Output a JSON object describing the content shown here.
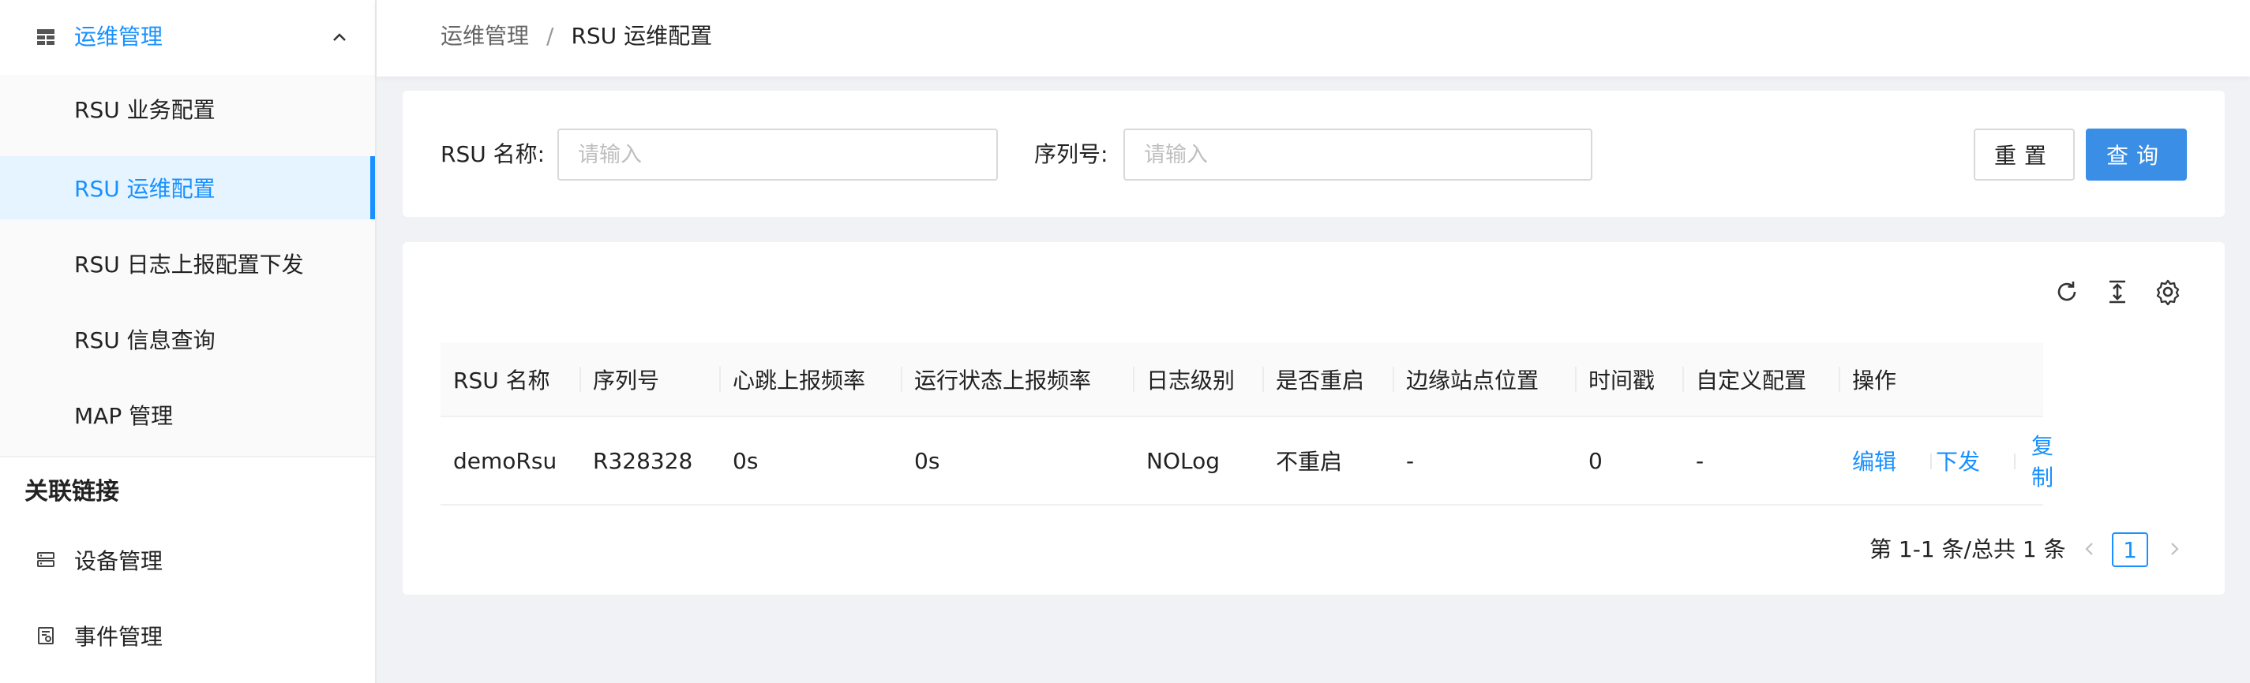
{
  "sidebar": {
    "group": {
      "label": "运维管理",
      "icon": "table-icon",
      "expanded": true
    },
    "submenu": [
      {
        "label": "RSU 业务配置",
        "active": false
      },
      {
        "label": "RSU 运维配置",
        "active": true
      },
      {
        "label": "RSU 日志上报配置下发",
        "active": false
      },
      {
        "label": "RSU 信息查询",
        "active": false
      },
      {
        "label": "MAP 管理",
        "active": false
      }
    ],
    "section_title": "关联链接",
    "links": [
      {
        "label": "设备管理",
        "icon": "server-icon"
      },
      {
        "label": "事件管理",
        "icon": "event-icon"
      }
    ]
  },
  "breadcrumb": {
    "parent": "运维管理",
    "separator": "/",
    "current": "RSU 运维配置"
  },
  "search": {
    "name_label": "RSU 名称:",
    "name_placeholder": "请输入",
    "serial_label": "序列号:",
    "serial_placeholder": "请输入",
    "reset_label": "重置",
    "query_label": "查询"
  },
  "toolbar": {
    "icons": [
      "refresh-icon",
      "column-height-icon",
      "settings-icon"
    ]
  },
  "table": {
    "columns": [
      "RSU 名称",
      "序列号",
      "心跳上报频率",
      "运行状态上报频率",
      "日志级别",
      "是否重启",
      "边缘站点位置",
      "时间戳",
      "自定义配置",
      "操作"
    ],
    "rows": [
      {
        "cells": [
          "demoRsu",
          "R328328",
          "0s",
          "0s",
          "NOLog",
          "不重启",
          "-",
          "0",
          "-"
        ],
        "actions": [
          "编辑",
          "下发",
          "复制"
        ]
      }
    ]
  },
  "pagination": {
    "total_text": "第 1-1 条/总共 1 条",
    "current_page": "1"
  },
  "colors": {
    "accent": "#1890ff",
    "primary_button": "#3a8ee6",
    "active_bg": "#e6f4ff",
    "page_bg": "#f0f2f5"
  }
}
